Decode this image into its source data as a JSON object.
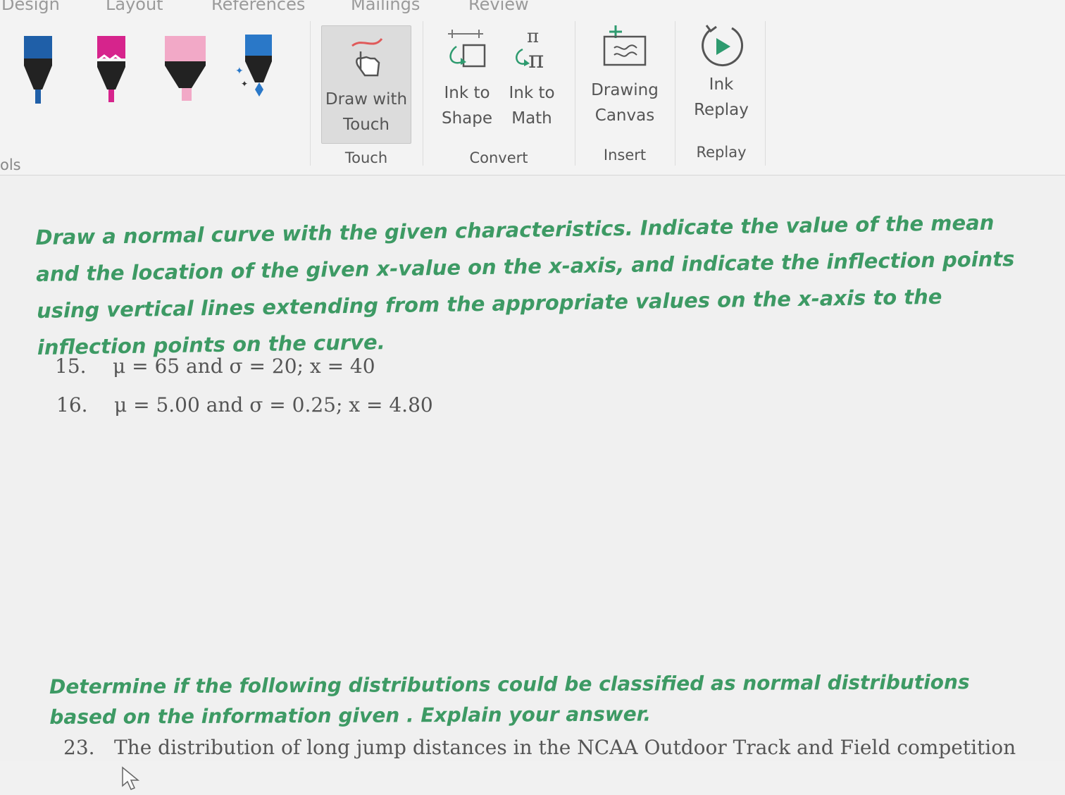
{
  "ribbon": {
    "tabs": [
      "Design",
      "Layout",
      "References",
      "Mailings",
      "Review"
    ],
    "left_group_label": "ols",
    "buttons": {
      "draw_with_touch": [
        "Draw with",
        "Touch"
      ],
      "ink_to_shape": [
        "Ink to",
        "Shape"
      ],
      "ink_to_math": [
        "Ink to",
        "Math"
      ],
      "drawing_canvas": [
        "Drawing",
        "Canvas"
      ],
      "ink_replay": [
        "Ink",
        "Replay"
      ]
    },
    "groups": {
      "touch": "Touch",
      "convert": "Convert",
      "insert": "Insert",
      "replay": "Replay"
    },
    "pens": [
      {
        "name": "blue-pen",
        "color": "#1f5fa8"
      },
      {
        "name": "magenta-pen",
        "color": "#d6248c"
      },
      {
        "name": "pink-highlighter",
        "color": "#f2a9c7"
      },
      {
        "name": "blue-sparkle-pen",
        "color": "#2a78c8"
      }
    ]
  },
  "document": {
    "instruction1": [
      "Draw a normal curve with the given characteristics. Indicate the value of the mean",
      "and the location of the given x-value on the x-axis, and indicate the inflection points",
      "using vertical lines extending from the appropriate values on the x-axis to the",
      "inflection points on the curve."
    ],
    "problems": [
      {
        "number": "15.",
        "text": "μ = 65 and σ = 20;   x = 40"
      },
      {
        "number": "16.",
        "text": "μ = 5.00 and σ = 0.25;   x = 4.80"
      }
    ],
    "instruction2": [
      "Determine if the following distributions could be classified as normal distributions",
      "based on the information given . Explain your answer."
    ],
    "problem23": {
      "number": "23.",
      "text": "The distribution of long jump distances in the NCAA Outdoor Track and Field competition"
    }
  },
  "colors": {
    "instruction": "#3d9a64",
    "ribbon_bg": "#f3f3f3",
    "accent": "#2e9b6f"
  }
}
